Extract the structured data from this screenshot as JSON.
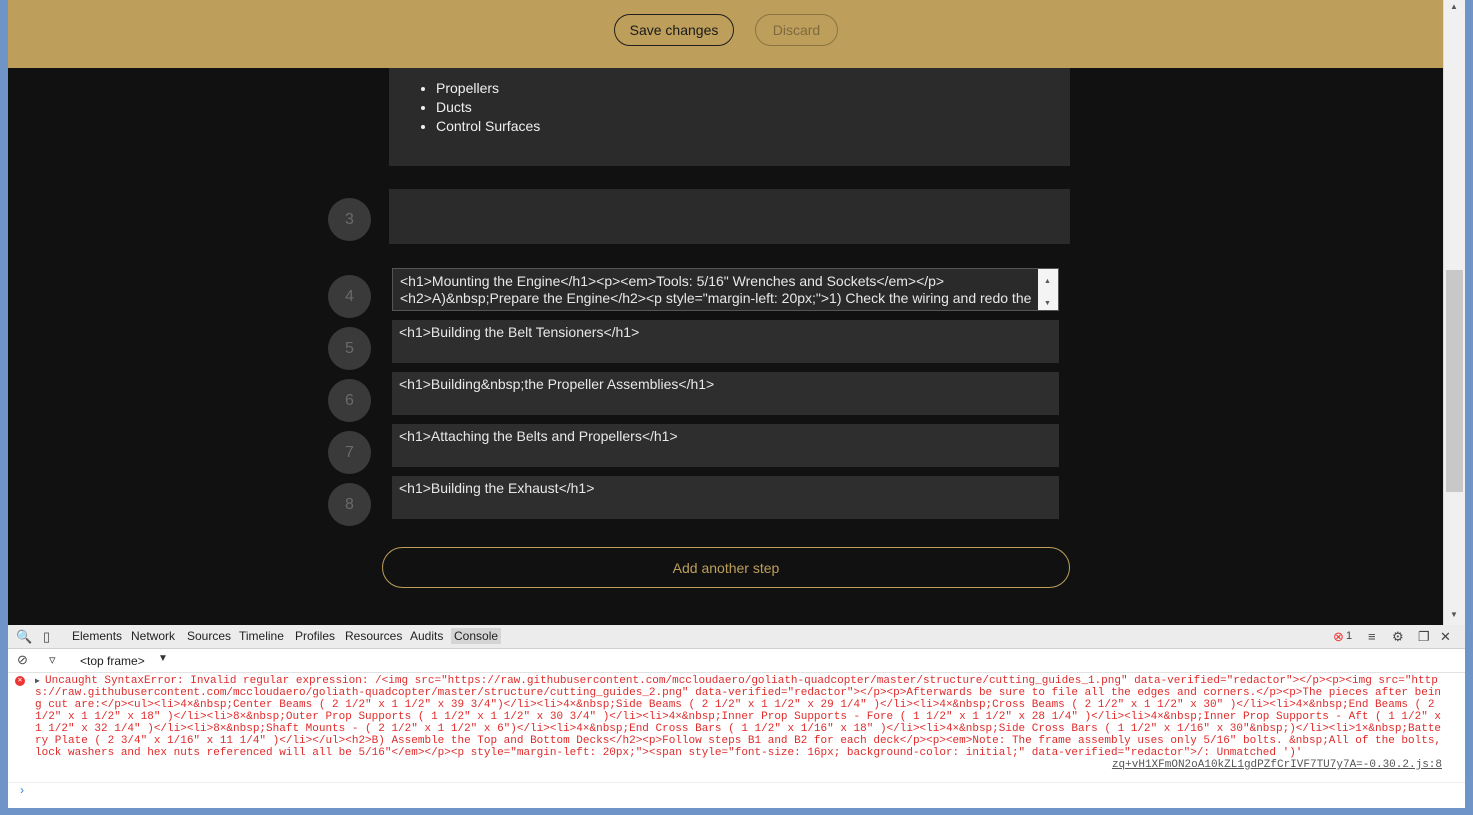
{
  "toolbar": {
    "save_label": "Save changes",
    "discard_label": "Discard"
  },
  "list_card": {
    "items": [
      "Propellers",
      "Ducts",
      "Control Surfaces"
    ]
  },
  "steps": [
    {
      "number": "3",
      "content": ""
    },
    {
      "number": "4",
      "line1": "<h1>Mounting the Engine</h1><p><em>Tools: 5/16\" Wrenches and Sockets</em></p>",
      "line2": "<h2>A)&nbsp;Prepare the Engine</h2><p style=\"margin-left: 20px;\">1) Check the wiring and redo the"
    },
    {
      "number": "5",
      "content": "<h1>Building the Belt Tensioners</h1>"
    },
    {
      "number": "6",
      "content": "<h1>Building&nbsp;the Propeller Assemblies</h1>"
    },
    {
      "number": "7",
      "content": "<h1>Attaching the Belts and Propellers</h1>"
    },
    {
      "number": "8",
      "content": "<h1>Building the Exhaust</h1>"
    }
  ],
  "add_step_label": "Add another step",
  "devtools": {
    "tabs": [
      "Elements",
      "Network",
      "Sources",
      "Timeline",
      "Profiles",
      "Resources",
      "Audits",
      "Console"
    ],
    "active_tab": "Console",
    "error_count": "1",
    "frame_selector": "<top frame>",
    "error_message": "Uncaught SyntaxError: Invalid regular expression: /<img src=\"https://raw.githubusercontent.com/mccloudaero/goliath-quadcopter/master/structure/cutting_guides_1.png\" data-verified=\"redactor\"></p><p><img src=\"https://raw.githubusercontent.com/mccloudaero/goliath-quadcopter/master/structure/cutting_guides_2.png\" data-verified=\"redactor\"></p><p>Afterwards be sure to file all the edges and corners.</p><p>The pieces after being cut are:</p><ul><li>4×&nbsp;Center Beams ( 2 1/2\" x 1 1/2\" x 39 3/4\")</li><li>4×&nbsp;Side Beams ( 2 1/2\" x 1 1/2\" x 29 1/4\" )</li><li>4×&nbsp;Cross Beams ( 2 1/2\" x 1 1/2\" x 30\" )</li><li>4×&nbsp;End Beams ( 2 1/2\" x 1 1/2\" x 18\" )</li><li>8×&nbsp;Outer Prop Supports ( 1 1/2\" x 1 1/2\" x 30 3/4\" )</li><li>4×&nbsp;Inner Prop Supports - Fore ( 1 1/2\" x 1 1/2\" x 28 1/4\" )</li><li>4×&nbsp;Inner Prop Supports - Aft ( 1 1/2\" x 1 1/2\" x 32 1/4\" )</li><li>8×&nbsp;Shaft Mounts - ( 2 1/2\" x 1 1/2\" x 6\")</li><li>4×&nbsp;End Cross Bars ( 1 1/2\" x 1/16\" x 18\" )</li><li>4×&nbsp;Side Cross Bars ( 1 1/2\" x 1/16\" x 30\"&nbsp;)</li><li>1×&nbsp;Battery Plate ( 2 3/4\" x 1/16\" x 11 1/4\" )</li></ul><h2>B) Assemble the Top and Bottom Decks</h2><p>Follow steps B1 and B2 for each deck</p><p><em>Note: The frame assembly uses only 5/16\" bolts. &nbsp;All of the bolts, lock washers and hex nuts referenced will all be 5/16\"</em></p><p style=\"margin-left: 20px;\"><span style=\"font-size: 16px; background-color: initial;\" data-verified=\"redactor\">/: Unmatched ')'",
    "error_source": "zq+vH1XFmON2oA10kZL1gdPZfCrIVF7TU7y7A=-0.30.2.js:8"
  }
}
